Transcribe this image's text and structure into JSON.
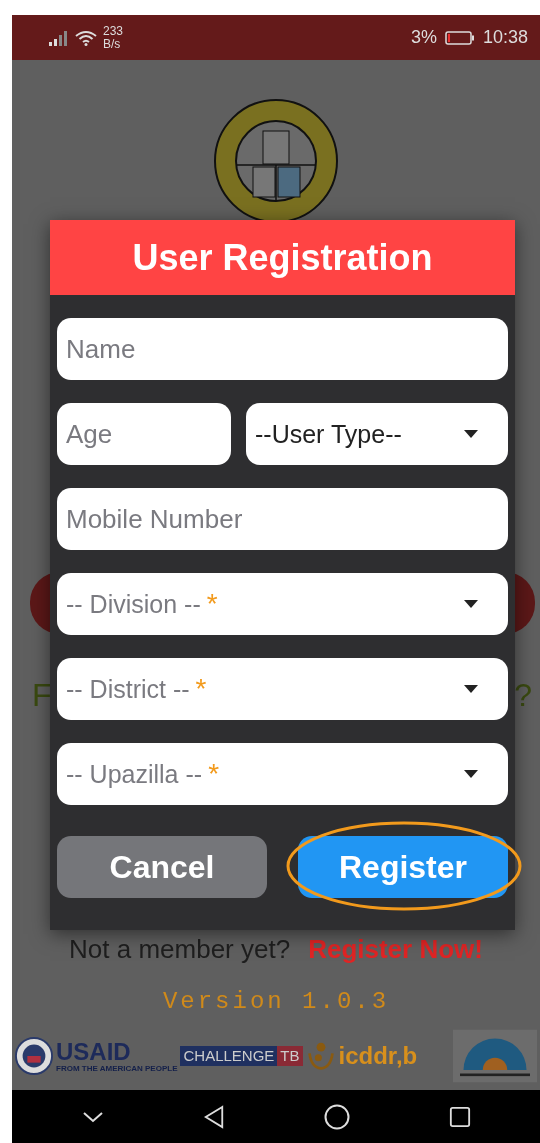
{
  "status_bar": {
    "speed_value": "233",
    "speed_unit": "B/s",
    "battery_percent": "3%",
    "time": "10:38"
  },
  "background": {
    "left_fragment": "F",
    "right_fragment": "?",
    "member_prompt": "Not a member yet?",
    "register_link": "Register Now!",
    "version": "Version 1.0.3",
    "sponsors": {
      "usaid": "USAID",
      "usaid_tagline": "FROM THE AMERICAN PEOPLE",
      "challenge": "CHALLENGE",
      "tb": "TB",
      "icddrb": "icddr,b"
    }
  },
  "dialog": {
    "title": "User Registration",
    "rows": [
      [
        {
          "kind": "text",
          "placeholder": "Name"
        }
      ],
      [
        {
          "kind": "text",
          "placeholder": "Age"
        },
        {
          "kind": "select",
          "value": "--User Type--"
        }
      ],
      [
        {
          "kind": "text",
          "placeholder": "Mobile Number"
        }
      ],
      [
        {
          "kind": "select",
          "placeholder": "-- Division --",
          "required_mark": "*"
        }
      ],
      [
        {
          "kind": "select",
          "placeholder": "-- District --",
          "required_mark": "*"
        }
      ],
      [
        {
          "kind": "select",
          "placeholder": "-- Upazilla --",
          "required_mark": "*"
        }
      ]
    ],
    "buttons": [
      {
        "label": "Cancel",
        "kind": "secondary",
        "highlighted": false
      },
      {
        "label": "Register",
        "kind": "primary",
        "highlighted": true
      }
    ]
  }
}
